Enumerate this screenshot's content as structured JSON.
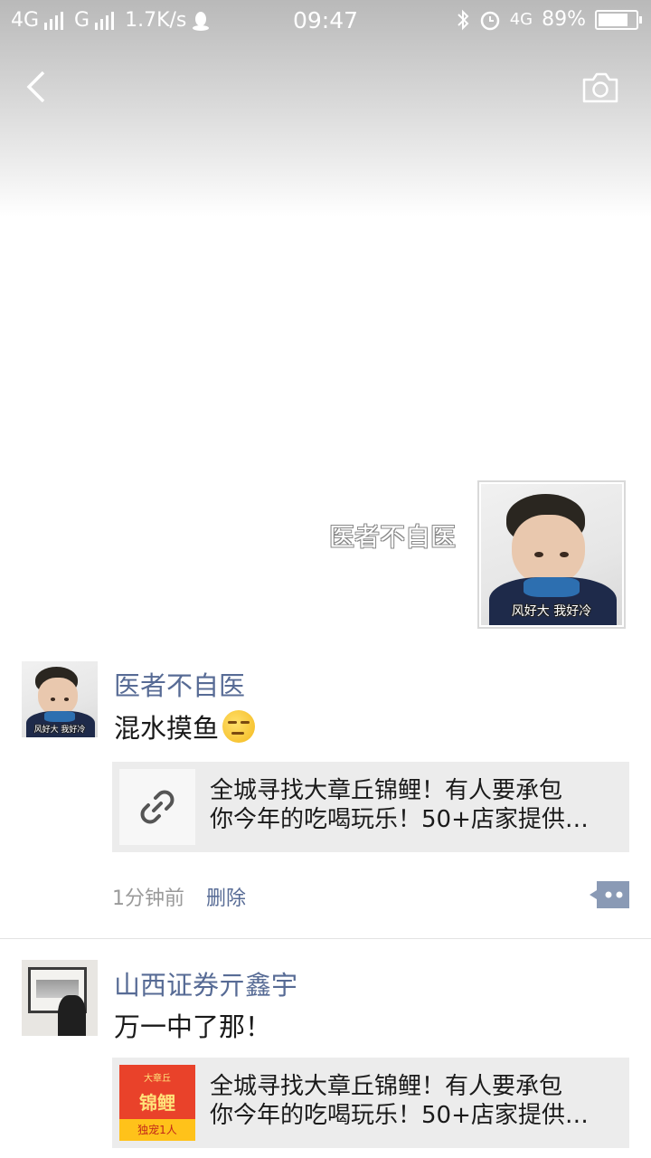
{
  "status_bar": {
    "net1": "4G",
    "net2": "G",
    "speed": "1.7K/s",
    "time": "09:47",
    "net3": "4G",
    "battery": "89%",
    "battery_level": 0.89
  },
  "nav": {
    "back_icon": "chevron-left-icon",
    "camera_icon": "camera-icon"
  },
  "profile": {
    "name": "医者不自医",
    "avatar_caption": "风好大 我好冷"
  },
  "posts": [
    {
      "author": "医者不自医",
      "avatar_caption": "风好大 我好冷",
      "text": "混水摸鱼",
      "emoji": "smirk-emoji",
      "link": {
        "title_line1": "全城寻找大章丘锦鲤！有人要承包",
        "title_line2": "你今年的吃喝玩乐！50+店家提供…",
        "thumb_icon": "link-icon"
      },
      "time": "1分钟前",
      "delete_label": "删除"
    },
    {
      "author": "山西证券亓鑫宇",
      "text": "万一中了那！",
      "link": {
        "title_line1": "全城寻找大章丘锦鲤！有人要承包",
        "title_line2": "你今年的吃喝玩乐！50+店家提供…",
        "thumb_top": "大章丘",
        "thumb_main": "锦鲤",
        "thumb_bottom": "独宠1人"
      }
    }
  ],
  "colors": {
    "link_name": "#576b95",
    "card_bg": "#ececec"
  }
}
